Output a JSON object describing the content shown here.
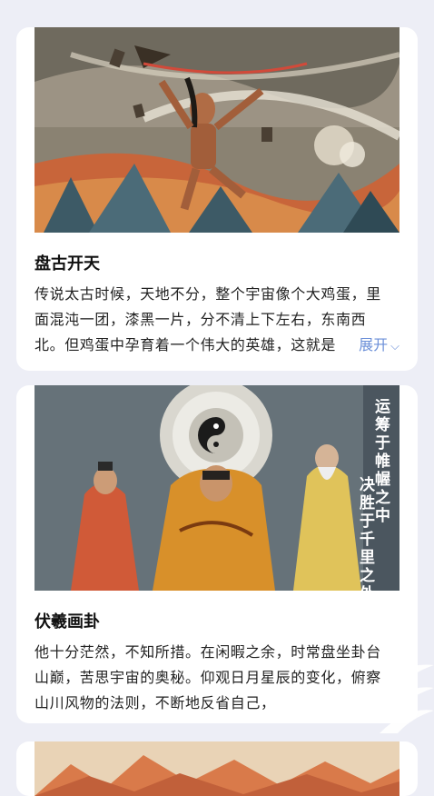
{
  "stories": [
    {
      "title": "盘古开天",
      "lines": [
        "传说太古时候，天地不分，整个宇宙像个大鸡蛋，里",
        "面混沌一团，漆黑一片，分不清上下左右，东南西",
        "北。但鸡蛋中孕育着一个伟大的英雄，这就是"
      ],
      "expand_label": "展开"
    },
    {
      "title": "伏羲画卦",
      "lines": [
        "他十分茫然，不知所措。在闲暇之余，时常盘坐卦台",
        "山巅，苦思宇宙的奥秘。仰观日月星辰的变化，俯察",
        "山川风物的法则，不断地反省自己，"
      ],
      "image_caption": [
        "运筹于帷幄之中",
        "决胜于千里之外"
      ]
    }
  ],
  "colors": {
    "accent": "#6b8fd8",
    "card_bg": "#ffffff",
    "page_bg": "#edeef6"
  }
}
